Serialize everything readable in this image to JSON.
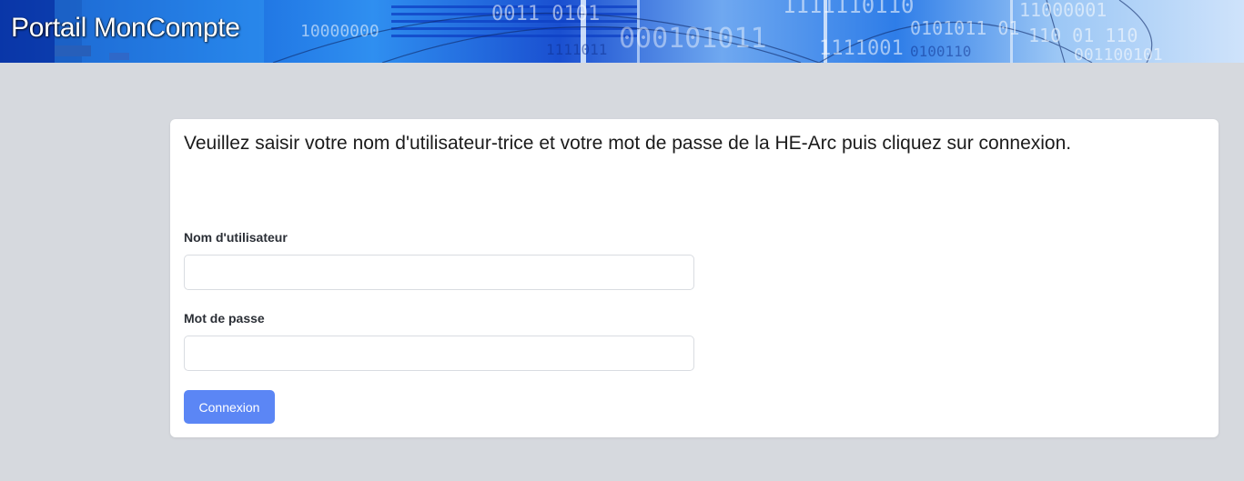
{
  "header": {
    "title": "Portail MonCompte"
  },
  "login": {
    "instructions": "Veuillez saisir votre nom d'utilisateur-trice et votre mot de passe de la HE-Arc puis cliquez sur connexion.",
    "username_label": "Nom d'utilisateur",
    "username_value": "",
    "password_label": "Mot de passe",
    "password_value": "",
    "submit_label": "Connexion"
  },
  "colors": {
    "page_background": "#d6d9de",
    "card_background": "#ffffff",
    "button_background": "#5b86f5",
    "button_text": "#ffffff"
  }
}
